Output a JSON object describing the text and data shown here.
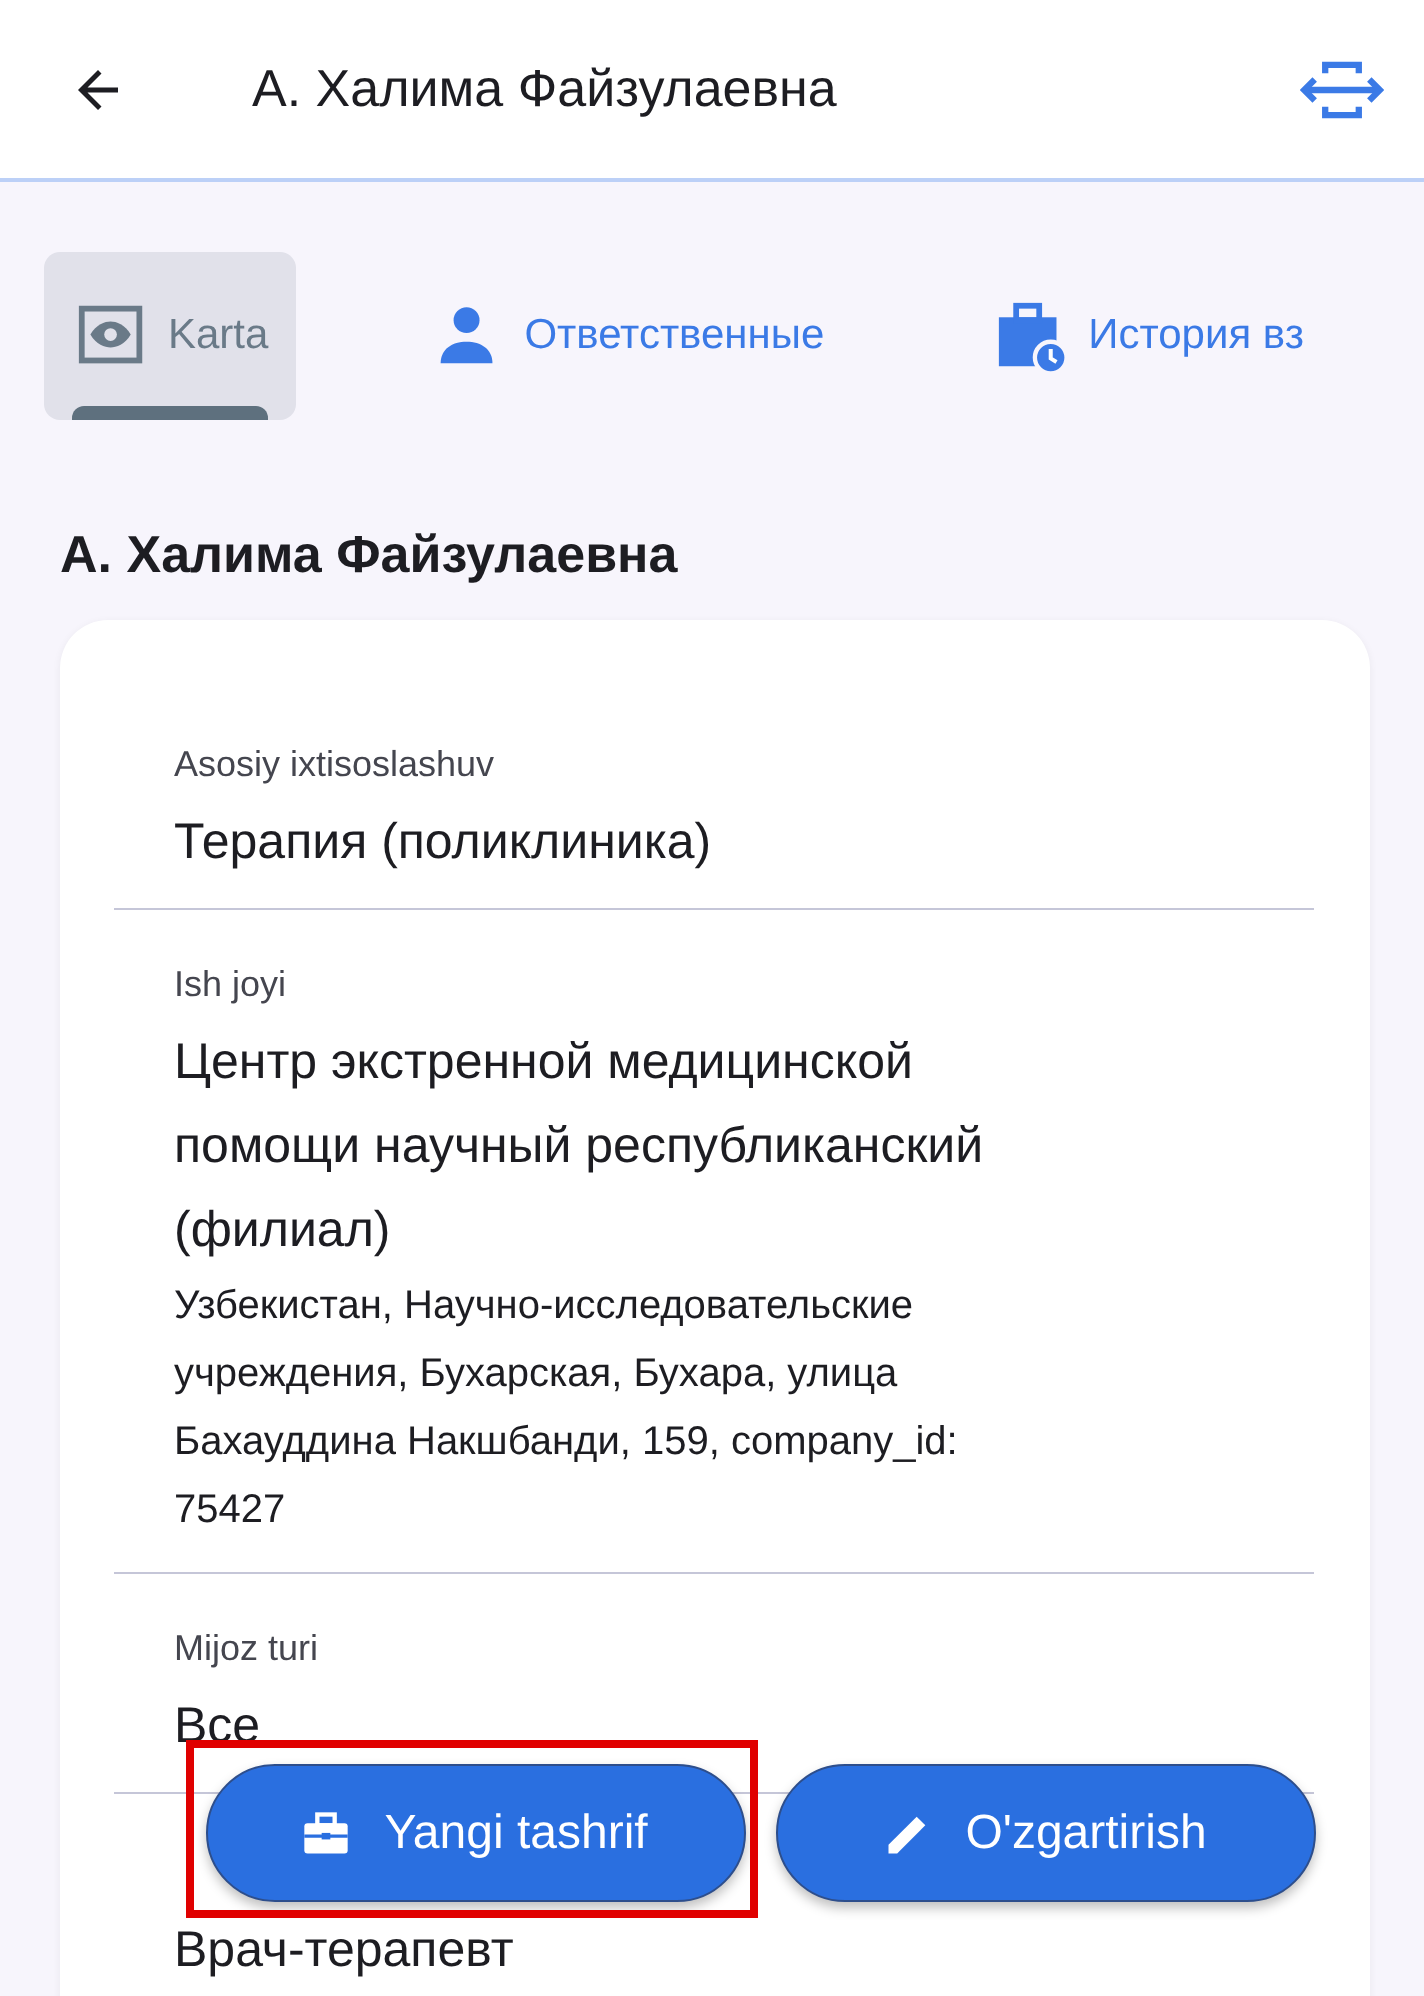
{
  "header": {
    "title": "А. Халима Файзулаевна"
  },
  "tabs": [
    {
      "label": "Karta",
      "selected": true,
      "kind": "eye"
    },
    {
      "label": "Ответственные",
      "selected": false,
      "kind": "person"
    },
    {
      "label": "История вз",
      "selected": false,
      "kind": "history"
    }
  ],
  "heading": "А. Халима Файзулаевна",
  "fields": [
    {
      "label": "Asosiy ixtisoslashuv",
      "value": "Терапия (поликлиника)"
    },
    {
      "label": "Ish joyi",
      "value": "Центр экстренной медицинской помощи научный республиканский (филиал)",
      "note": "Узбекистан, Научно-исследовательские учреждения, Бухарская, Бухара, улица Бахауддина Накшбанди, 159, company_id: 75427"
    },
    {
      "label": "Mijoz turi",
      "value": "Все"
    },
    {
      "value": "Врач-терапевт"
    }
  ],
  "actions": [
    {
      "label": "Yangi tashrif",
      "kind": "briefcase",
      "highlighted": true
    },
    {
      "label": "O'zgartirish",
      "kind": "pencil",
      "highlighted": false
    }
  ]
}
